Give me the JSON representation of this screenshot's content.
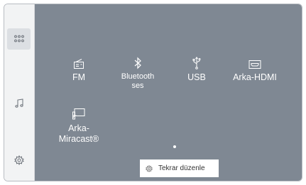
{
  "sidebar": {
    "items": [
      {
        "icon": "apps-grid-icon",
        "active": true
      },
      {
        "icon": "music-note-icon",
        "active": false
      },
      {
        "icon": "gear-icon",
        "active": false
      }
    ]
  },
  "sources": [
    {
      "label": "FM",
      "icon": "radio-icon"
    },
    {
      "label": "Bluetooth ses",
      "line1": "Bluetooth",
      "line2": "ses",
      "icon": "bluetooth-icon"
    },
    {
      "label": "USB",
      "icon": "usb-icon"
    },
    {
      "label": "Arka-HDMI",
      "icon": "hdmi-icon"
    },
    {
      "label": "Arka-Miracast®",
      "line1": "Arka-",
      "line2": "Miracast®",
      "icon": "miracast-icon"
    }
  ],
  "pager": {
    "current_page": 1
  },
  "reorder_button": {
    "label": "Tekrar düzenle",
    "icon": "gear-icon"
  },
  "colors": {
    "main_bg": "#7f8893",
    "sidebar_bg": "#f2f3f4",
    "text": "#ffffff"
  }
}
